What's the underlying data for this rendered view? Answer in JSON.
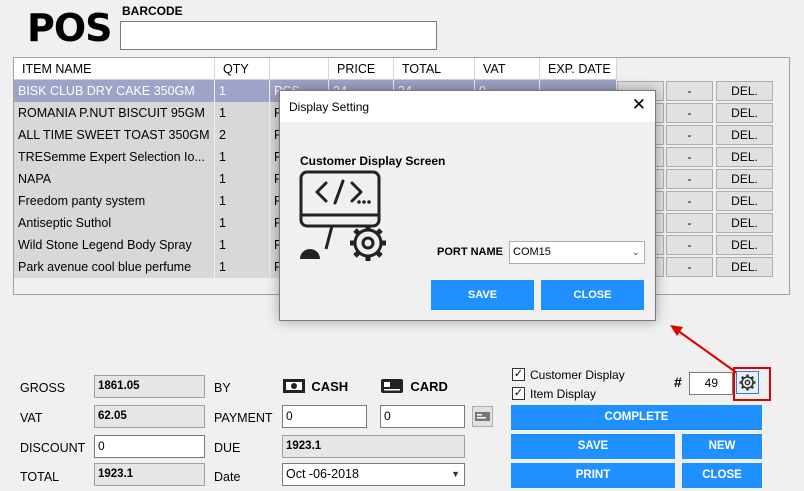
{
  "header": {
    "logo": "POS",
    "barcode_label": "BARCODE",
    "barcode_value": ""
  },
  "grid": {
    "columns": [
      "ITEM NAME",
      "QTY",
      "",
      "PRICE",
      "TOTAL",
      "VAT",
      "EXP. DATE"
    ],
    "rows": [
      {
        "name": "BISK CLUB DRY CAKE 350GM",
        "qty": "1",
        "unit": "PCS",
        "price": "24",
        "total": "24",
        "vat": "0",
        "selected": true
      },
      {
        "name": "ROMANIA P.NUT BISCUIT 95GM",
        "qty": "1",
        "unit": "P",
        "selected": false
      },
      {
        "name": "ALL TIME SWEET TOAST 350GM",
        "qty": "2",
        "unit": "P",
        "selected": false
      },
      {
        "name": "TRESemme Expert Selection Io...",
        "qty": "1",
        "unit": "P",
        "selected": false
      },
      {
        "name": "NAPA",
        "qty": "1",
        "unit": "P",
        "selected": false
      },
      {
        "name": "Freedom panty system",
        "qty": "1",
        "unit": "P",
        "selected": false
      },
      {
        "name": "Antiseptic Suthol",
        "qty": "1",
        "unit": "P",
        "selected": false
      },
      {
        "name": "Wild Stone Legend Body Spray",
        "qty": "1",
        "unit": "P",
        "selected": false
      },
      {
        "name": "Park avenue cool blue perfume",
        "qty": "1",
        "unit": "P",
        "selected": false
      }
    ],
    "minus_label": "-",
    "del_label": "DEL."
  },
  "dialog": {
    "title": "Display Setting",
    "close_glyph": "✕",
    "heading": "Customer Display Screen",
    "port_label": "PORT NAME",
    "port_value": "COM15",
    "save_label": "SAVE",
    "close_label": "CLOSE"
  },
  "totals": {
    "gross_label": "GROSS",
    "gross_value": "1861.05",
    "vat_label": "VAT",
    "vat_value": "62.05",
    "discount_label": "DISCOUNT",
    "discount_value": "0",
    "total_label": "TOTAL",
    "total_value": "1923.1"
  },
  "payment": {
    "by_label": "BY",
    "cash_label": "CASH",
    "card_label": "CARD",
    "payment_label": "PAYMENT",
    "cash_value": "0",
    "card_value": "0",
    "due_label": "DUE",
    "due_value": "1923.1",
    "date_label": "Date",
    "date_value": "Oct -06-2018"
  },
  "options": {
    "customer_display_label": "Customer Display",
    "customer_display_checked": true,
    "item_display_label": "Item Display",
    "item_display_checked": true,
    "hash_label": "#",
    "invoice_number": "49"
  },
  "actions": {
    "complete_label": "COMPLETE",
    "save_label": "SAVE",
    "new_label": "NEW",
    "print_label": "PRINT",
    "close_label": "CLOSE"
  },
  "colors": {
    "accent": "#1e90ff",
    "annotation": "#e00000",
    "selected_row": "#9ea3c8"
  }
}
